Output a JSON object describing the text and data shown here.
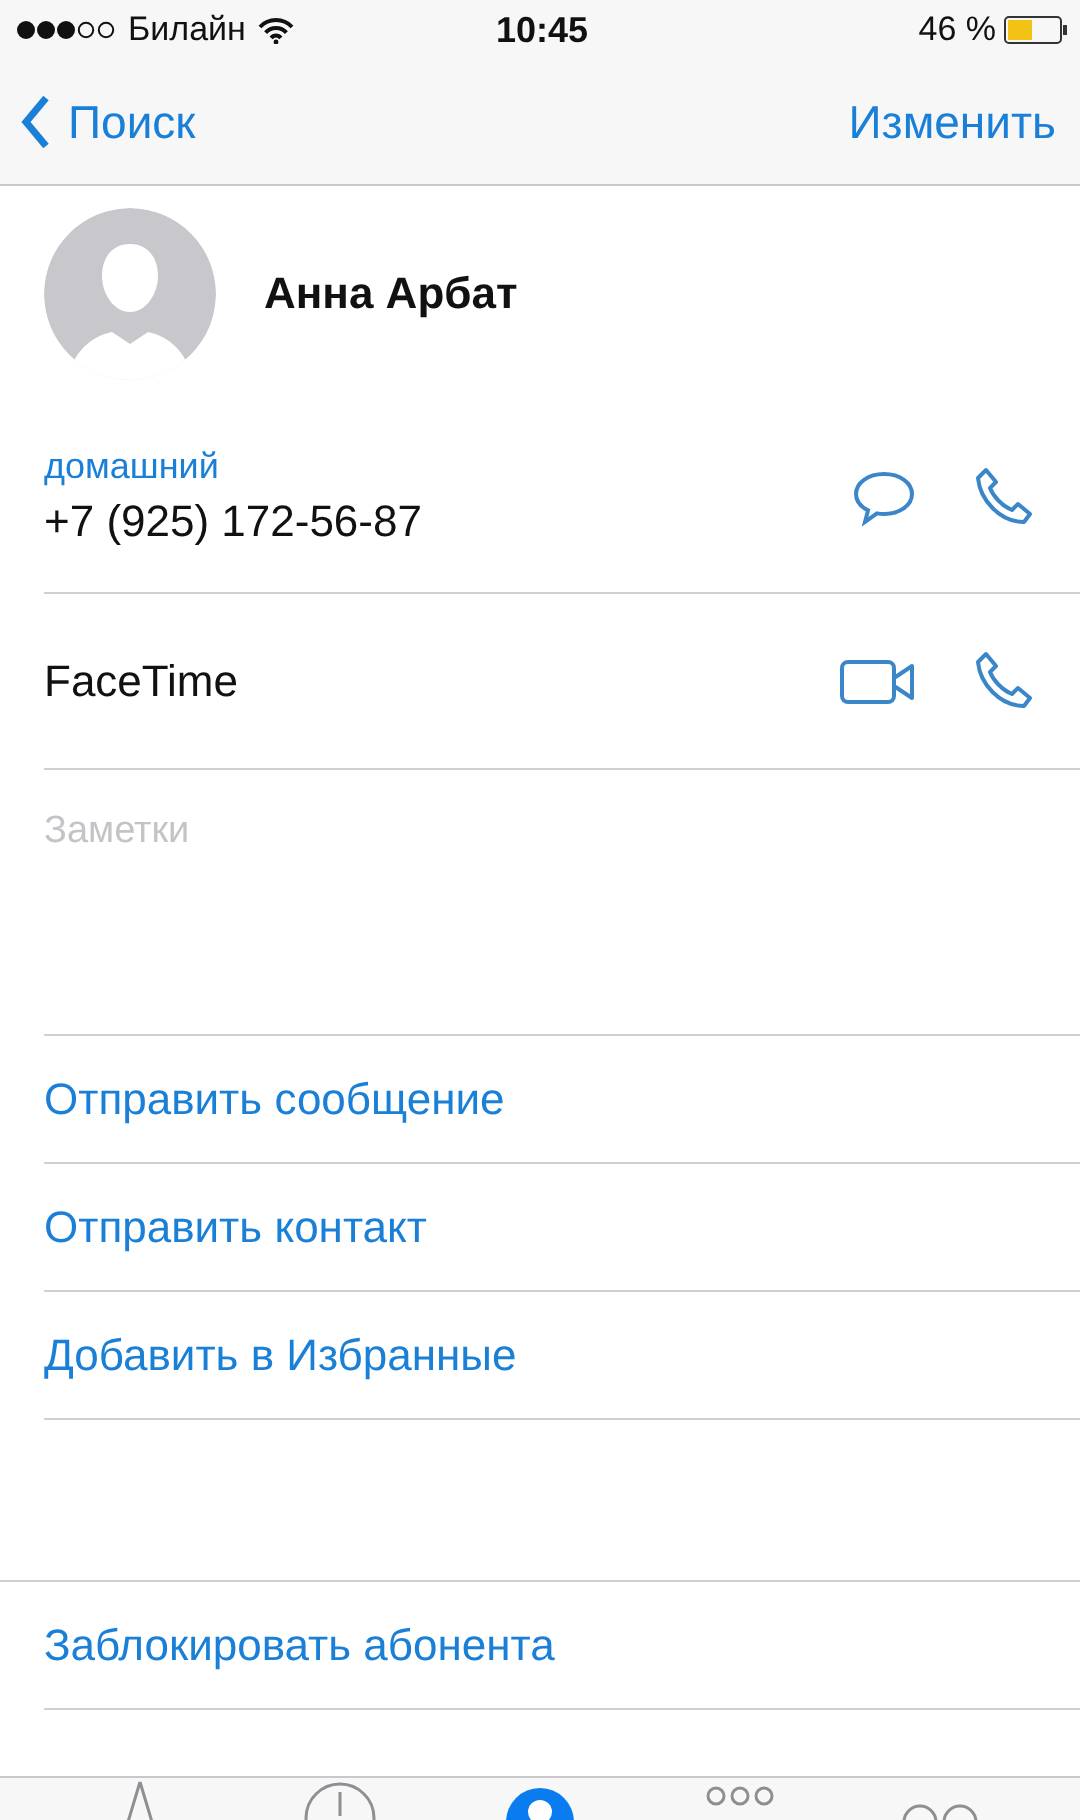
{
  "status_bar": {
    "carrier": "Билайн",
    "time": "10:45",
    "battery": "46 %"
  },
  "nav": {
    "back": "Поиск",
    "edit": "Изменить"
  },
  "contact": {
    "name": "Анна Арбат"
  },
  "fields": [
    {
      "kind": "phone",
      "label": "домашний",
      "value": "+7 (925) 172-56-87"
    },
    {
      "kind": "facetime",
      "value": "FaceTime"
    }
  ],
  "notes": {
    "placeholder": "Заметки"
  },
  "actions": [
    "Отправить сообщение",
    "Отправить контакт",
    "Добавить в Избранные"
  ],
  "block_action": "Заблокировать абонента",
  "tab_bar": [
    {
      "selected": false
    },
    {
      "selected": false
    },
    {
      "selected": true
    },
    {
      "selected": false
    },
    {
      "selected": false
    }
  ]
}
